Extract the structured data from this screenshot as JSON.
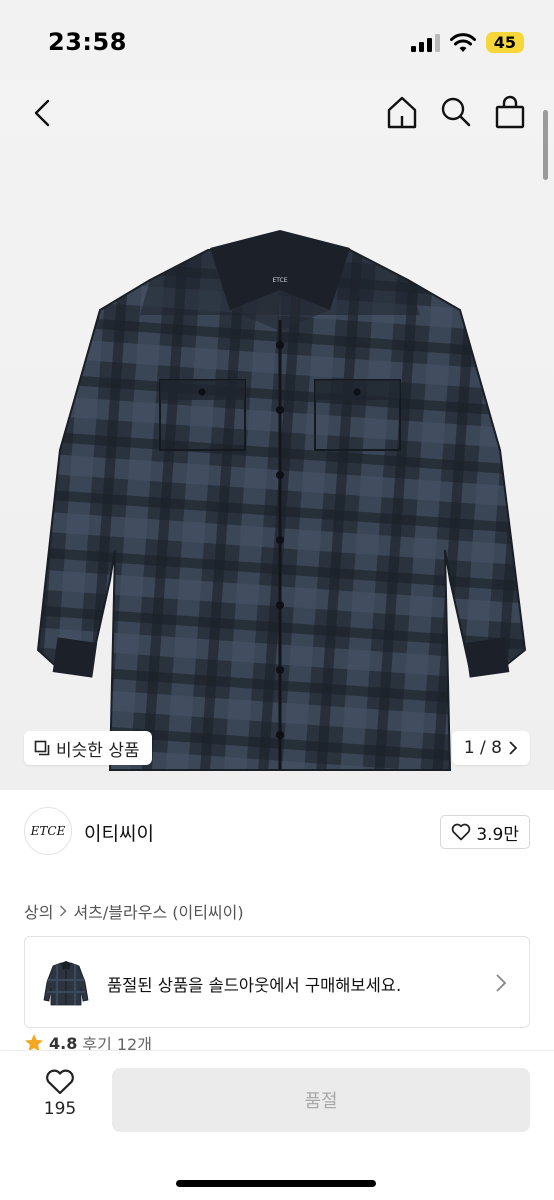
{
  "status_bar": {
    "time": "23:58",
    "battery": "45"
  },
  "nav": {
    "back_icon": "chevron-left-icon",
    "home_icon": "home-icon",
    "search_icon": "search-icon",
    "bag_icon": "shopping-bag-icon"
  },
  "product_image": {
    "garment_label": "ETCE",
    "colors": {
      "dark": "#1f242c",
      "check": "#3d4a5c"
    }
  },
  "similar_button": {
    "label": "비슷한 상품"
  },
  "image_counter": {
    "text": "1 / 8"
  },
  "brand": {
    "logo_text": "ETCE",
    "name": "이티씨이",
    "likes": "3.9만"
  },
  "breadcrumb": {
    "category": "상의",
    "subcategory": "셔츠/블라우스 (이티씨이)"
  },
  "soldout_banner": {
    "text": "품절된 상품을 솔드아웃에서 구매해보세요."
  },
  "review": {
    "rating": "4.8",
    "label": "후기 12개"
  },
  "bottom_bar": {
    "wish_count": "195",
    "buy_label": "품절"
  },
  "accent_colors": {
    "star": "#f5a623",
    "battery": "#f7d63a"
  }
}
